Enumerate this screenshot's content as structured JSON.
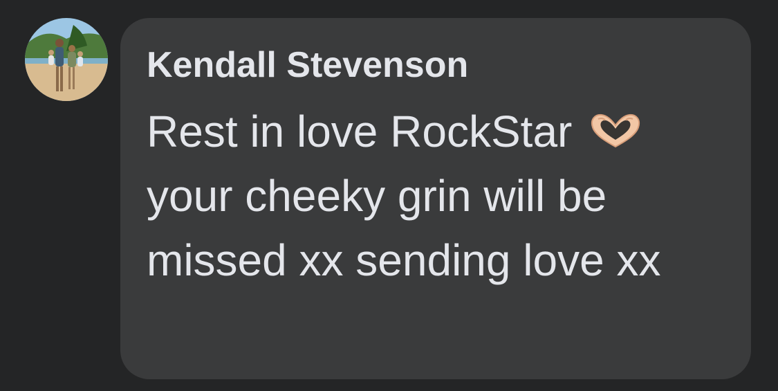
{
  "comment": {
    "author": "Kendall Stevenson",
    "text": "Rest in love RockStar",
    "text_continued": "your cheeky grin will be missed xx sending love xx",
    "reaction_icon": "heart-hands-icon",
    "avatar_icon": "profile-photo-beach-family"
  },
  "colors": {
    "background": "#242526",
    "bubble": "#3a3b3c",
    "text": "#e4e6eb"
  }
}
